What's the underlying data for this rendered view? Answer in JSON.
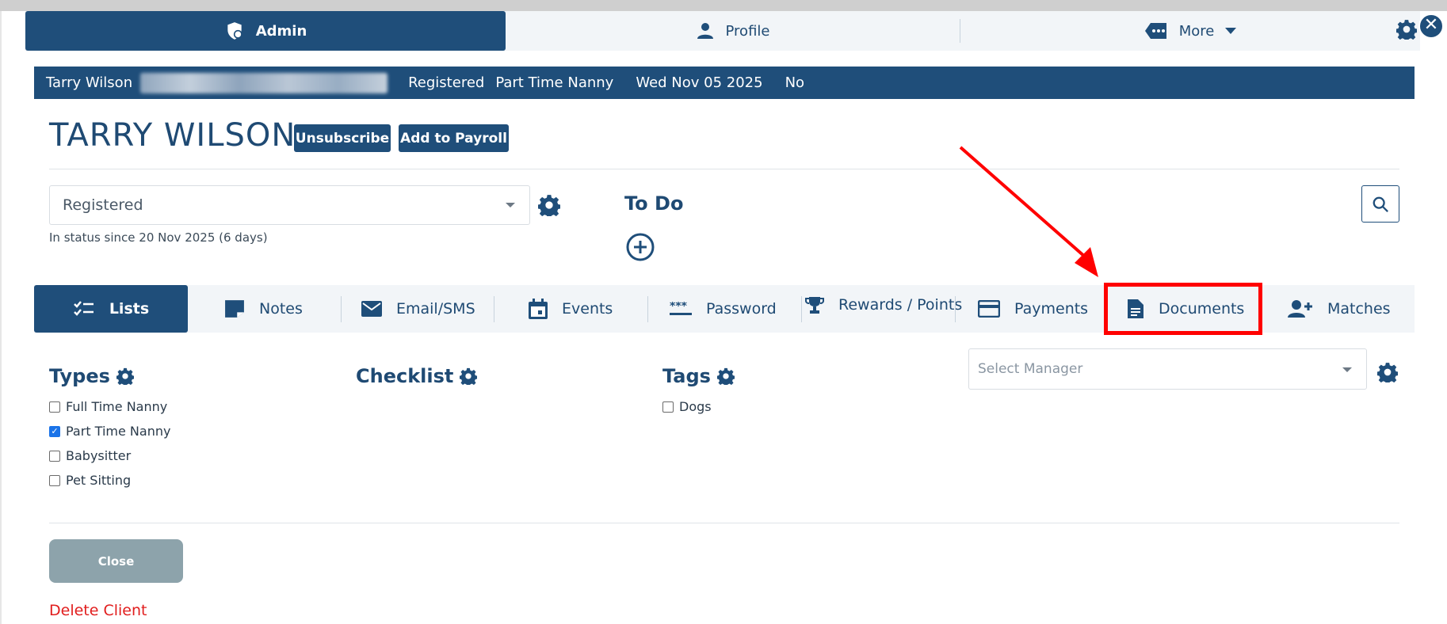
{
  "top_tabs": {
    "admin": "Admin",
    "profile": "Profile",
    "more": "More"
  },
  "info_bar": {
    "name": "Tarry Wilson",
    "status": "Registered",
    "type": "Part Time Nanny",
    "date": "Wed Nov 05 2025",
    "flag": "No"
  },
  "header": {
    "title": "TARRY WILSON",
    "unsubscribe": "Unsubscribe",
    "add_payroll": "Add to Payroll"
  },
  "status": {
    "value": "Registered",
    "since": "In status since 20 Nov 2025 (6 days)"
  },
  "todo": {
    "title": "To Do"
  },
  "tabs": [
    {
      "label": "Lists",
      "icon": "checklist-icon"
    },
    {
      "label": "Notes",
      "icon": "note-icon"
    },
    {
      "label": "Email/SMS",
      "icon": "mail-icon"
    },
    {
      "label": "Events",
      "icon": "calendar-icon"
    },
    {
      "label": "Password",
      "icon": "password-icon"
    },
    {
      "label": "Rewards / Points",
      "icon": "trophy-icon"
    },
    {
      "label": "Payments",
      "icon": "credit-card-icon"
    },
    {
      "label": "Documents",
      "icon": "document-icon"
    },
    {
      "label": "Matches",
      "icon": "add-user-icon"
    }
  ],
  "types": {
    "title": "Types",
    "items": [
      {
        "label": "Full Time Nanny",
        "checked": false
      },
      {
        "label": "Part Time Nanny",
        "checked": true
      },
      {
        "label": "Babysitter",
        "checked": false
      },
      {
        "label": "Pet Sitting",
        "checked": false
      }
    ]
  },
  "checklist": {
    "title": "Checklist"
  },
  "tags": {
    "title": "Tags",
    "items": [
      {
        "label": "Dogs",
        "checked": false
      }
    ]
  },
  "manager": {
    "placeholder": "Select Manager"
  },
  "footer": {
    "close": "Close",
    "delete": "Delete Client"
  },
  "colors": {
    "primary": "#1f4e7a",
    "highlight": "#ff0000",
    "danger": "#e11d1d",
    "close_btn": "#8da3ab"
  }
}
